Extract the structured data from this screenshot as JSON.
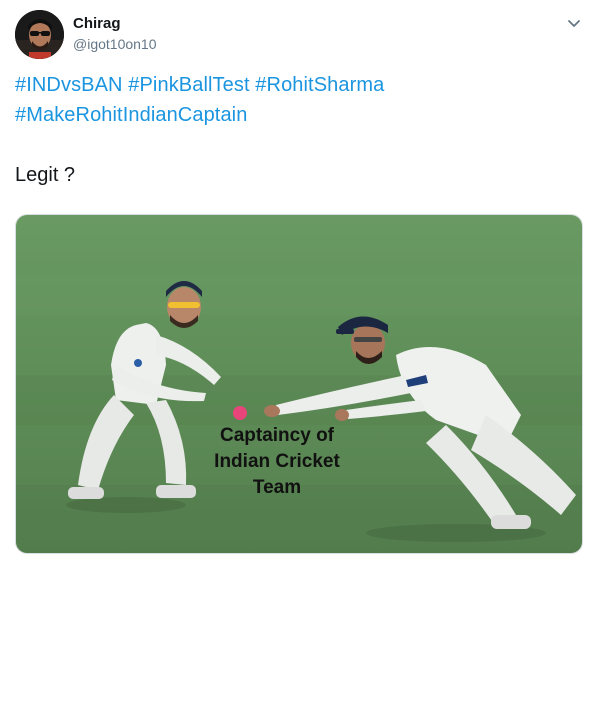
{
  "user": {
    "display_name": "Chirag",
    "handle": "@igot10on10"
  },
  "tweet": {
    "hashtags": [
      "#INDvsBAN",
      "#PinkBallTest",
      "#RohitSharma",
      "#MakeRohitIndianCaptain"
    ],
    "body": "Legit ?"
  },
  "media": {
    "caption": "Captaincy of Indian Cricket Team"
  },
  "colors": {
    "hashtag": "#1b95e0",
    "text": "#14171a",
    "secondary": "#657786",
    "field": "#5f8c58"
  },
  "icons": {
    "more": "chevron-down-icon"
  }
}
